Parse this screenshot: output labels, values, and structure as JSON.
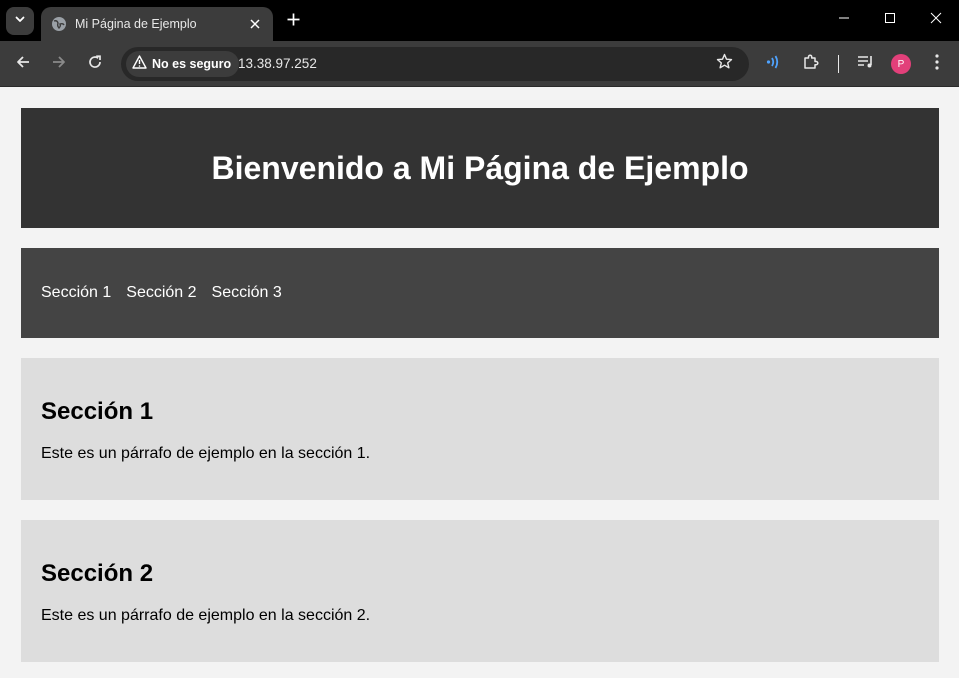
{
  "browser": {
    "tab_title": "Mi Página de Ejemplo",
    "security_label": "No es seguro",
    "url": "13.38.97.252",
    "profile_initial": "P",
    "colors": {
      "frame": "#000000",
      "toolbar": "#3c3c3c",
      "omnibox": "#282828",
      "avatar": "#e2407a",
      "cast_accent": "#4fa3ff"
    }
  },
  "page": {
    "header_title": "Bienvenido a Mi Página de Ejemplo",
    "nav": [
      "Sección 1",
      "Sección 2",
      "Sección 3"
    ],
    "sections": [
      {
        "heading": "Sección 1",
        "text": "Este es un párrafo de ejemplo en la sección 1."
      },
      {
        "heading": "Sección 2",
        "text": "Este es un párrafo de ejemplo en la sección 2."
      }
    ],
    "colors": {
      "background": "#f3f3f3",
      "header": "#333333",
      "nav": "#444444",
      "section": "#dddddd"
    }
  }
}
